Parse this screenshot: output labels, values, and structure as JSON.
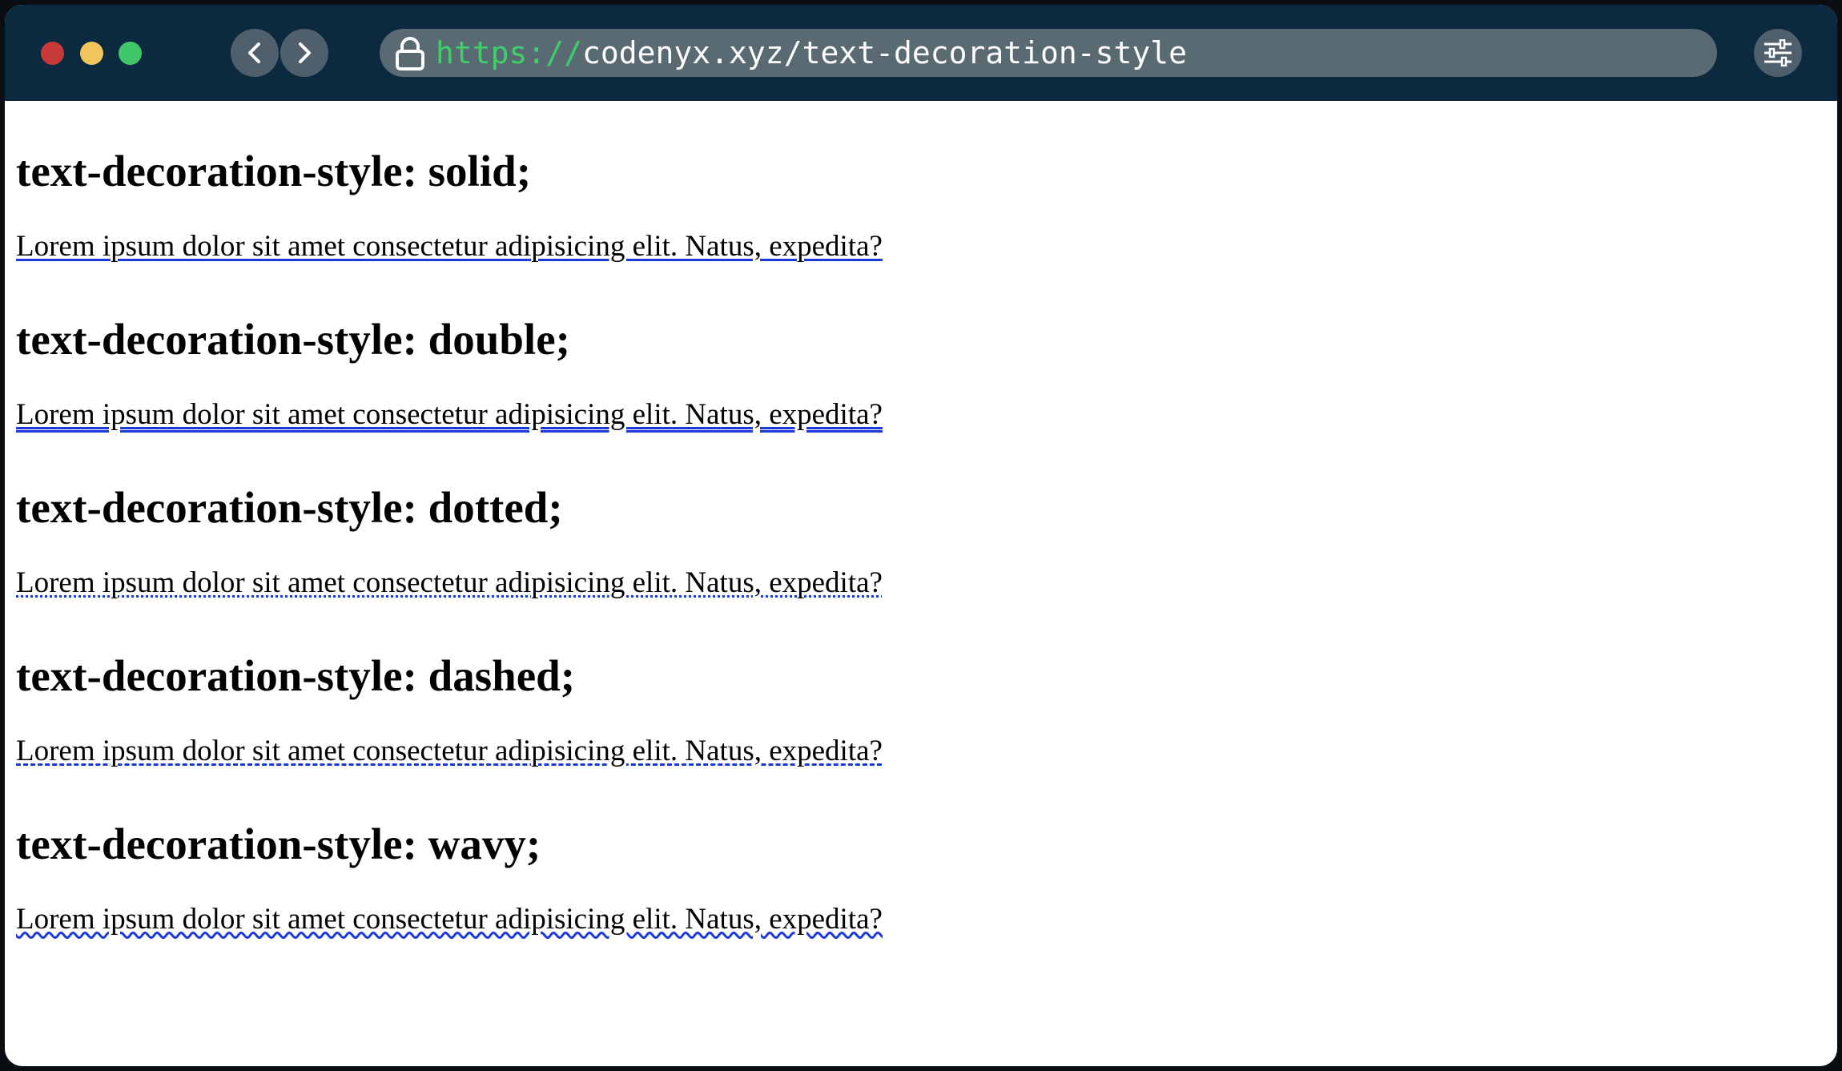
{
  "browser": {
    "url_scheme": "https://",
    "url_rest": "codenyx.xyz/text-decoration-style",
    "traffic_colors": {
      "close": "#c83a3a",
      "minimize": "#f2c55c",
      "maximize": "#41c76a"
    },
    "icons": {
      "back": "chevron-left-icon",
      "forward": "chevron-right-icon",
      "lock": "lock-icon",
      "settings": "sliders-icon"
    }
  },
  "page": {
    "sections": [
      {
        "heading": "text-decoration-style: solid;",
        "style": "solid",
        "text": "Lorem ipsum dolor sit amet consectetur adipisicing elit. Natus, expedita?"
      },
      {
        "heading": "text-decoration-style: double;",
        "style": "double",
        "text": "Lorem ipsum dolor sit amet consectetur adipisicing elit. Natus, expedita?"
      },
      {
        "heading": "text-decoration-style: dotted;",
        "style": "dotted",
        "text": "Lorem ipsum dolor sit amet consectetur adipisicing elit. Natus, expedita?"
      },
      {
        "heading": "text-decoration-style: dashed;",
        "style": "dashed",
        "text": "Lorem ipsum dolor sit amet consectetur adipisicing elit. Natus, expedita?"
      },
      {
        "heading": "text-decoration-style: wavy;",
        "style": "wavy",
        "text": "Lorem ipsum dolor sit amet consectetur adipisicing elit. Natus, expedita?"
      }
    ],
    "decoration_color": "#1a3adb"
  }
}
